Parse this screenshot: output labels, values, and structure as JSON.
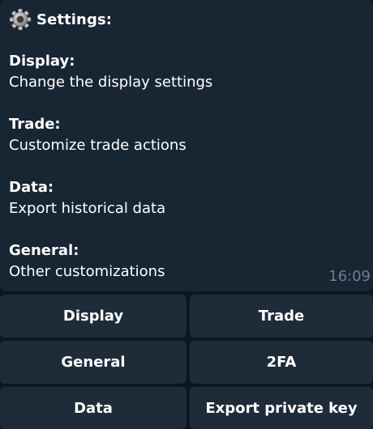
{
  "message": {
    "title": "Settings:",
    "title_icon": "gear-icon",
    "sections": [
      {
        "heading": "Display:",
        "description": "Change the display settings"
      },
      {
        "heading": "Trade:",
        "description": "Customize trade actions"
      },
      {
        "heading": "Data:",
        "description": "Export historical data"
      },
      {
        "heading": "General:",
        "description": "Other customizations"
      }
    ],
    "time": "16:09"
  },
  "keyboard": {
    "buttons": [
      {
        "label": "Display"
      },
      {
        "label": "Trade"
      },
      {
        "label": "General"
      },
      {
        "label": "2FA"
      },
      {
        "label": "Data"
      },
      {
        "label": "Export private key"
      }
    ]
  },
  "colors": {
    "background": "#0e1621",
    "bubble": "#182533",
    "button": "#1e2c3a",
    "time": "#6d7f8f"
  }
}
